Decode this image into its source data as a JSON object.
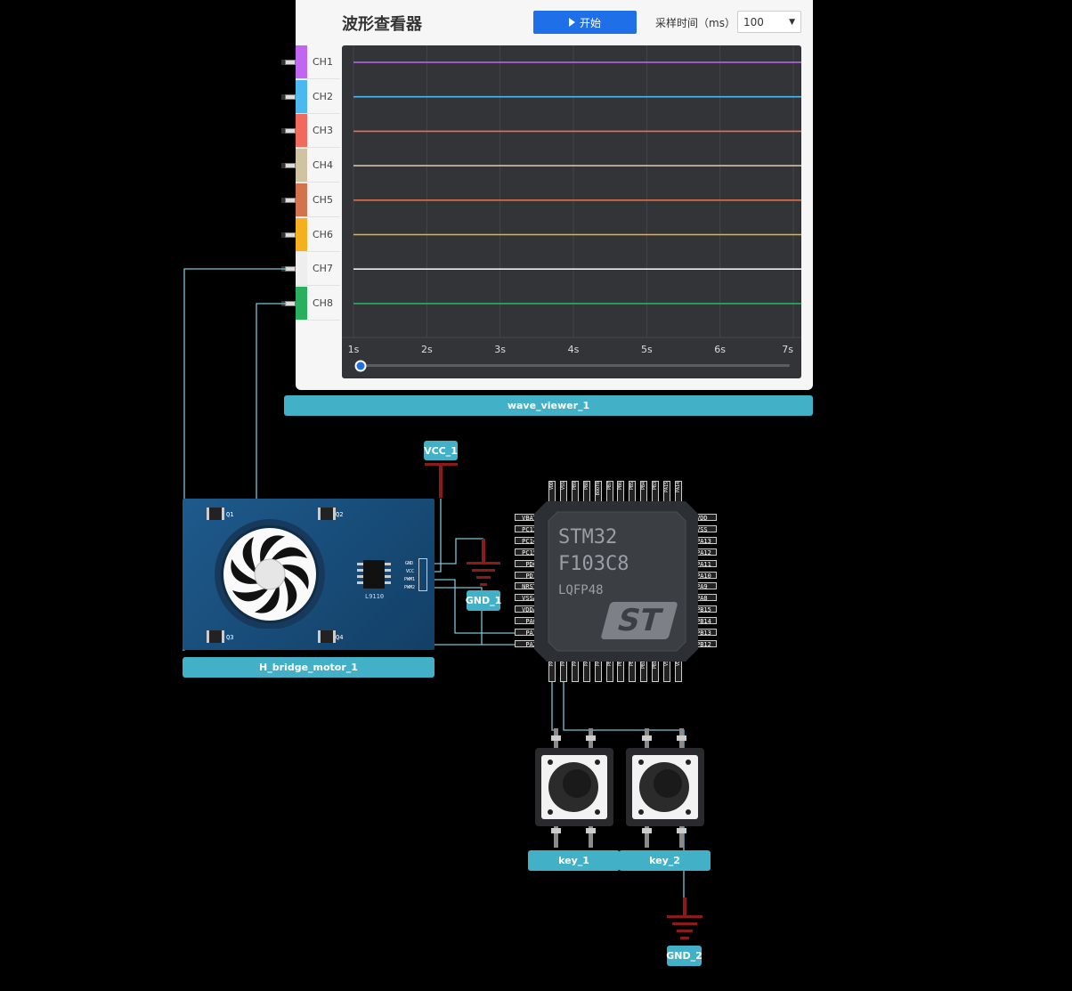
{
  "wave_viewer": {
    "title": "波形查看器",
    "start_label": "开始",
    "sample_label": "采样时间（ms）",
    "sample_value": "100",
    "channels": [
      {
        "label": "CH1",
        "color": "#c066f0"
      },
      {
        "label": "CH2",
        "color": "#4bb8f0"
      },
      {
        "label": "CH3",
        "color": "#f06a5e"
      },
      {
        "label": "CH4",
        "color": "#cfc3a4"
      },
      {
        "label": "CH5",
        "color": "#d2734e"
      },
      {
        "label": "CH6",
        "color": "#f5b020"
      },
      {
        "label": "CH7",
        "color": "#eeeeee"
      },
      {
        "label": "CH8",
        "color": "#2aaf5e"
      }
    ],
    "time_ticks": [
      "1s",
      "2s",
      "3s",
      "4s",
      "5s",
      "6s",
      "7s"
    ],
    "slider_position": 0,
    "component_name": "wave_viewer_1"
  },
  "vcc": {
    "name": "VCC_1"
  },
  "gnd1": {
    "name": "GND_1"
  },
  "gnd2": {
    "name": "GND_2"
  },
  "motor": {
    "name": "H_bridge_motor_1",
    "driver_chip": "L9110",
    "pins": [
      "GND",
      "VCC",
      "PWM1",
      "PWM2"
    ],
    "transistors": [
      "Q1",
      "Q2",
      "Q3",
      "Q4"
    ]
  },
  "mcu": {
    "line1": "STM32",
    "line2": "F103C8",
    "line3": "LQFP48",
    "logo": "ST",
    "left_pins": [
      "VBAT",
      "PC13",
      "PC14",
      "PC15",
      "PD0",
      "PD1",
      "NRST",
      "VSSA",
      "VDDA",
      "PA0",
      "PA1",
      "PA2"
    ],
    "right_pins": [
      "VDD",
      "VSS",
      "PA13",
      "PA12",
      "PA11",
      "PA10",
      "PA9",
      "PA8",
      "PB15",
      "PB14",
      "PB13",
      "PB12"
    ],
    "top_pins": [
      "VDD",
      "VSS",
      "PB9",
      "PB8",
      "BOOT0",
      "PB7",
      "PB6",
      "PB5",
      "PB4",
      "PB3",
      "PA15",
      "PA14"
    ],
    "bottom_pins": [
      "PA3",
      "PA4",
      "PA5",
      "PA6",
      "PA7",
      "PB0",
      "PB1",
      "PB2",
      "PB10",
      "PB11",
      "VSS",
      "VDD"
    ]
  },
  "keys": [
    {
      "name": "key_1"
    },
    {
      "name": "key_2"
    }
  ],
  "colors": {
    "wire": "#7ec3d6",
    "power": "#8b1a1a",
    "label_bg": "#42b0c6"
  }
}
